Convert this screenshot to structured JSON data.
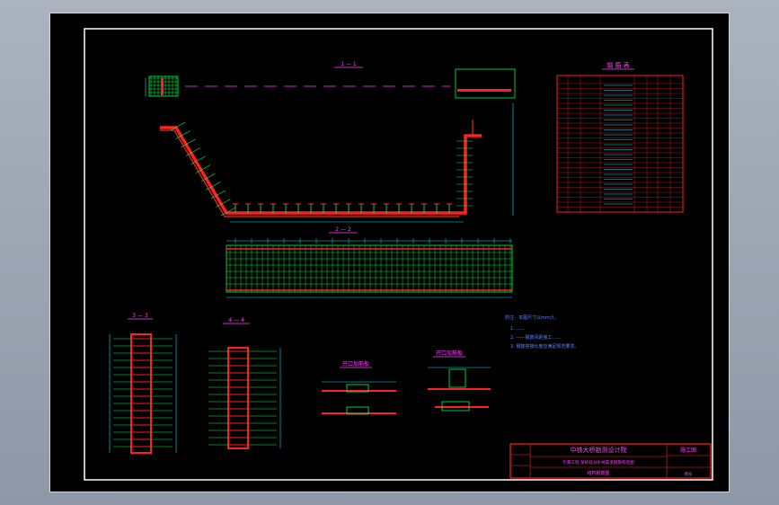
{
  "drawing": {
    "section_1_label": "1 — 1",
    "section_2_label": "2 — 2",
    "section_3_label": "3 — 3",
    "section_4_label": "4 — 4",
    "detail_a_title": "开口加筋板",
    "detail_b_title": "开口加筋板"
  },
  "material_table": {
    "title": "钢 筋 表"
  },
  "notes": {
    "lines": [
      "附注：本图尺寸以mm计。",
      "1. ……",
      "2. ——钢筋间距施工……",
      "3. 钢筋搭接长度应满足规范要求。"
    ]
  },
  "title_block": {
    "company": "中铁大桥勘测设计院",
    "project": "引黄工程 某标段分水闸渠道钢筋构造图",
    "sheet_title": "结构钢筋图",
    "stage": "施工图",
    "drawing_no": "图号"
  },
  "colors": {
    "background": "#000000",
    "rebar_main": "#ff2020",
    "rebar_dist": "#00ff40",
    "dimension": "#00e0ff",
    "label": "#ff40ff",
    "frame": "#ffffff",
    "note": "#6080ff"
  }
}
